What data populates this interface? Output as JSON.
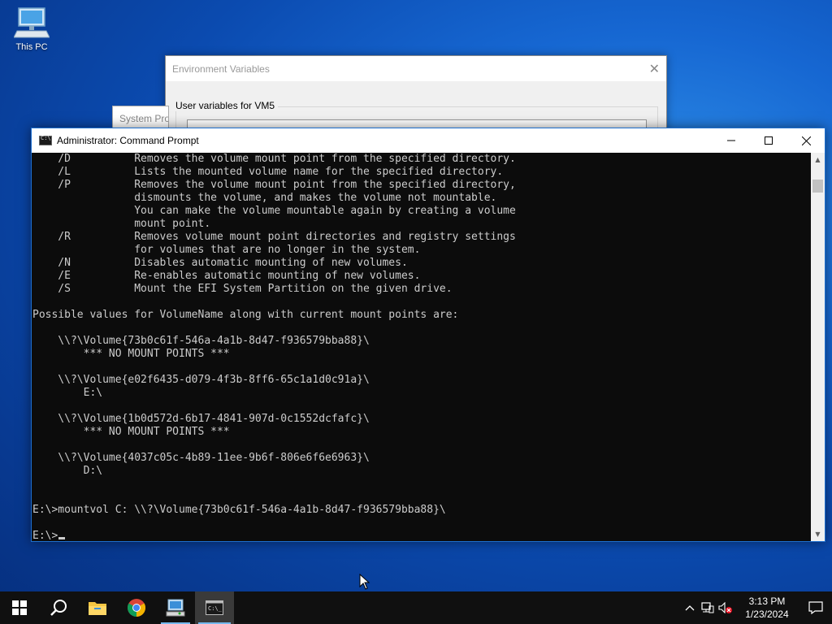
{
  "desktop": {
    "icons": [
      {
        "label": "This PC"
      }
    ]
  },
  "env_window": {
    "title": "Environment Variables",
    "group_label": "User variables for VM5"
  },
  "sys_window": {
    "title": "System Properties"
  },
  "cmd_window": {
    "title": "Administrator: Command Prompt",
    "lines": [
      "    /D          Removes the volume mount point from the specified directory.",
      "    /L          Lists the mounted volume name for the specified directory.",
      "    /P          Removes the volume mount point from the specified directory,",
      "                dismounts the volume, and makes the volume not mountable.",
      "                You can make the volume mountable again by creating a volume",
      "                mount point.",
      "    /R          Removes volume mount point directories and registry settings",
      "                for volumes that are no longer in the system.",
      "    /N          Disables automatic mounting of new volumes.",
      "    /E          Re-enables automatic mounting of new volumes.",
      "    /S          Mount the EFI System Partition on the given drive.",
      "",
      "Possible values for VolumeName along with current mount points are:",
      "",
      "    \\\\?\\Volume{73b0c61f-546a-4a1b-8d47-f936579bba88}\\",
      "        *** NO MOUNT POINTS ***",
      "",
      "    \\\\?\\Volume{e02f6435-d079-4f3b-8ff6-65c1a1d0c91a}\\",
      "        E:\\",
      "",
      "    \\\\?\\Volume{1b0d572d-6b17-4841-907d-0c1552dcfafc}\\",
      "        *** NO MOUNT POINTS ***",
      "",
      "    \\\\?\\Volume{4037c05c-4b89-11ee-9b6f-806e6f6e6963}\\",
      "        D:\\",
      "",
      "",
      "E:\\>mountvol C: \\\\?\\Volume{73b0c61f-546a-4a1b-8d47-f936579bba88}\\",
      ""
    ],
    "prompt": "E:\\>"
  },
  "taskbar": {
    "apps": [
      {
        "name": "start-icon"
      },
      {
        "name": "search-icon"
      },
      {
        "name": "file-explorer-icon"
      },
      {
        "name": "chrome-icon"
      },
      {
        "name": "system-properties-icon"
      },
      {
        "name": "command-prompt-icon"
      }
    ],
    "clock": {
      "time": "3:13 PM",
      "date": "1/23/2024"
    }
  }
}
